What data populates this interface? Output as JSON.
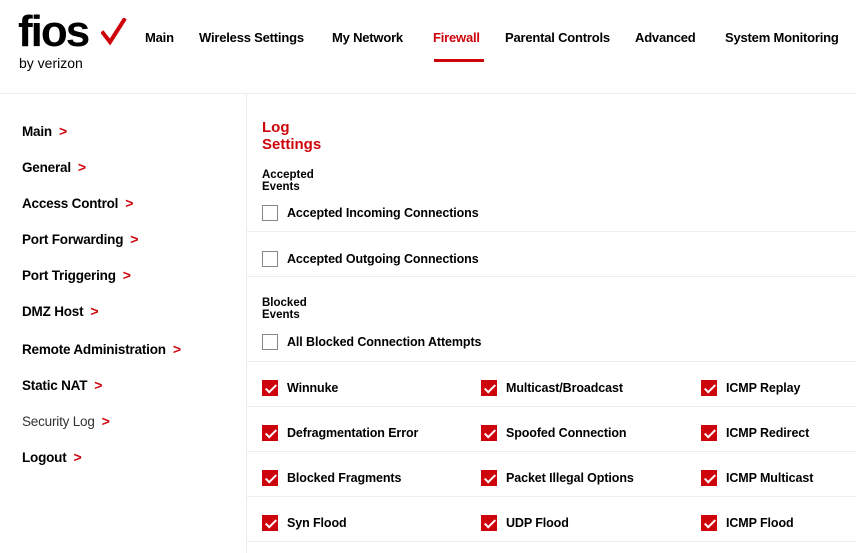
{
  "brand": {
    "logo_word": "fios",
    "logo_sub": "by verizon",
    "accent": "#cd040b"
  },
  "topnav": [
    {
      "label": "Main"
    },
    {
      "label": "Wireless Settings"
    },
    {
      "label": "My Network"
    },
    {
      "label": "Firewall",
      "active": true
    },
    {
      "label": "Parental Controls"
    },
    {
      "label": "Advanced"
    },
    {
      "label": "System Monitoring"
    }
  ],
  "sidebar": {
    "items": [
      {
        "label": "Main"
      },
      {
        "label": "General"
      },
      {
        "label": "Access Control"
      },
      {
        "label": "Port Forwarding"
      },
      {
        "label": "Port Triggering"
      },
      {
        "label": "DMZ Host"
      },
      {
        "label": "Remote Administration"
      },
      {
        "label": "Static NAT"
      },
      {
        "label": "Security Log",
        "current": true
      },
      {
        "label": "Logout"
      }
    ],
    "chevron": ">"
  },
  "main": {
    "title": "Log Settings",
    "accepted_events": {
      "label": "Accepted Events",
      "options": [
        {
          "label": "Accepted Incoming Connections",
          "checked": false
        },
        {
          "label": "Accepted Outgoing Connections",
          "checked": false
        }
      ]
    },
    "blocked_events": {
      "label": "Blocked Events",
      "all_option": {
        "label": "All Blocked Connection Attempts",
        "checked": false
      },
      "options": [
        {
          "label": "Winnuke",
          "checked": true
        },
        {
          "label": "Multicast/Broadcast",
          "checked": true
        },
        {
          "label": "ICMP Replay",
          "checked": true
        },
        {
          "label": "Defragmentation Error",
          "checked": true
        },
        {
          "label": "Spoofed Connection",
          "checked": true
        },
        {
          "label": "ICMP Redirect",
          "checked": true
        },
        {
          "label": "Blocked Fragments",
          "checked": true
        },
        {
          "label": "Packet Illegal Options",
          "checked": true
        },
        {
          "label": "ICMP Multicast",
          "checked": true
        },
        {
          "label": "Syn Flood",
          "checked": true
        },
        {
          "label": "UDP Flood",
          "checked": true
        },
        {
          "label": "ICMP Flood",
          "checked": true
        }
      ]
    }
  }
}
